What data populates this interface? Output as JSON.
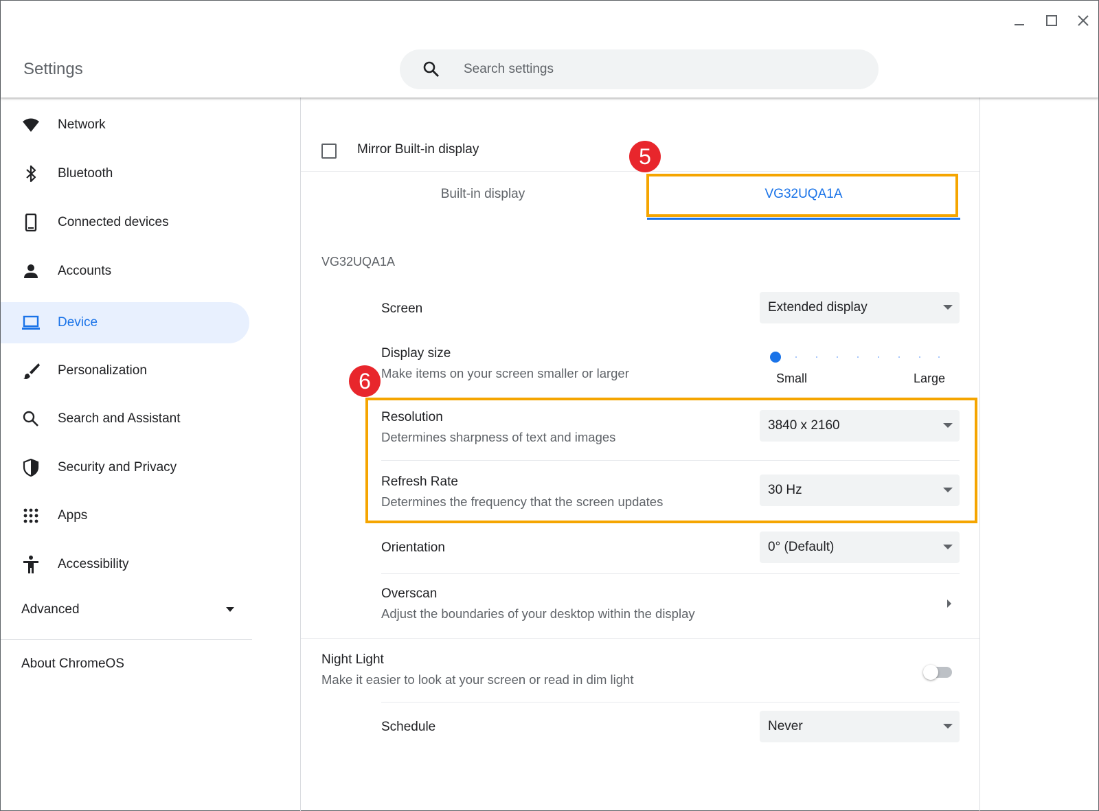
{
  "window": {
    "title": "Settings",
    "controls": [
      "minimize-icon",
      "maximize-icon",
      "close-icon"
    ]
  },
  "search": {
    "icon": "search-icon",
    "placeholder": "Search settings",
    "value": ""
  },
  "sidebar": {
    "items": [
      {
        "label": "Network",
        "icon": "wifi-icon"
      },
      {
        "label": "Bluetooth",
        "icon": "bluetooth-icon"
      },
      {
        "label": "Connected devices",
        "icon": "phone-icon"
      },
      {
        "label": "Accounts",
        "icon": "person-icon"
      },
      {
        "label": "Device",
        "icon": "laptop-icon",
        "active": true
      },
      {
        "label": "Personalization",
        "icon": "brush-icon"
      },
      {
        "label": "Search and Assistant",
        "icon": "search-icon"
      },
      {
        "label": "Security and Privacy",
        "icon": "shield-icon"
      },
      {
        "label": "Apps",
        "icon": "apps-grid-icon"
      },
      {
        "label": "Accessibility",
        "icon": "accessibility-icon"
      }
    ],
    "advanced_label": "Advanced",
    "about_label": "About ChromeOS"
  },
  "display": {
    "mirror_label": "Mirror Built-in display",
    "mirror_checked": false,
    "tabs": [
      {
        "label": "Built-in display",
        "active": false
      },
      {
        "label": "VG32UQA1A",
        "active": true
      }
    ],
    "section_title": "VG32UQA1A",
    "screen": {
      "label": "Screen",
      "value": "Extended display"
    },
    "display_size": {
      "label": "Display size",
      "sub": "Make items on your screen smaller or larger",
      "min_label": "Small",
      "max_label": "Large",
      "level": 0
    },
    "resolution": {
      "label": "Resolution",
      "sub": "Determines sharpness of text and images",
      "value": "3840 x 2160"
    },
    "refresh_rate": {
      "label": "Refresh Rate",
      "sub": "Determines the frequency that the screen updates",
      "value": "30 Hz"
    },
    "orientation": {
      "label": "Orientation",
      "value": "0° (Default)"
    },
    "overscan": {
      "label": "Overscan",
      "sub": "Adjust the boundaries of your desktop within the display"
    },
    "night_light": {
      "label": "Night Light",
      "sub": "Make it easier to look at your screen or read in dim light",
      "enabled": false
    },
    "schedule": {
      "label": "Schedule",
      "value": "Never"
    }
  },
  "annotations": {
    "step5": "5",
    "step6": "6",
    "highlight_color": "#f5a500",
    "badge_color": "#e8262c"
  },
  "colors": {
    "accent": "#1a73e8",
    "active_nav_bg": "#e8f0fe"
  }
}
